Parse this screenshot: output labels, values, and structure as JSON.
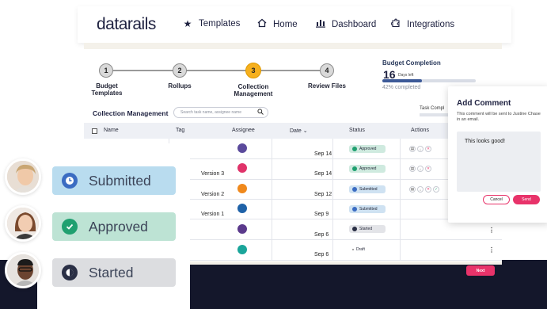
{
  "nav": {
    "logo": "datarails",
    "items": [
      {
        "label": "Templates",
        "icon": "star-icon"
      },
      {
        "label": "Home",
        "icon": "home-icon"
      },
      {
        "label": "Dashboard",
        "icon": "bar-chart-icon"
      },
      {
        "label": "Integrations",
        "icon": "puzzle-icon"
      }
    ]
  },
  "stepper": [
    {
      "num": "1",
      "label": "Budget\nTemplates"
    },
    {
      "num": "2",
      "label": "Rollups"
    },
    {
      "num": "3",
      "label": "Collection\nManagement"
    },
    {
      "num": "4",
      "label": "Review Files"
    }
  ],
  "budget": {
    "title": "Budget Completion",
    "days": "16",
    "days_label": "Days left",
    "completed": "42% completed",
    "progress": 0.42
  },
  "collection": {
    "title": "Collection Management",
    "search_placeholder": "Search task name, assignee name",
    "task_completion": "Task Compl"
  },
  "table": {
    "headers": {
      "name": "Name",
      "tag": "Tag",
      "assignee": "Assignee",
      "date": "Date",
      "status": "Status",
      "actions": "Actions"
    },
    "rows": [
      {
        "version": "",
        "date": "Sep 14",
        "assignee_color": "#5b4a9c",
        "status": "Approved"
      },
      {
        "version": "Version 3",
        "date": "Sep 14",
        "assignee_color": "#e0336a",
        "status": "Approved"
      },
      {
        "version": "Version 2",
        "date": "Sep 12",
        "assignee_color": "#f0891c",
        "status": "Submitted"
      },
      {
        "version": "Version 1",
        "date": "Sep 9",
        "assignee_color": "#1f62a8",
        "status": "Submitted"
      },
      {
        "version": "",
        "date": "Sep 6",
        "assignee_color": "#5b3a8c",
        "status": "Started"
      },
      {
        "version": "",
        "date": "Sep 6",
        "assignee_color": "#1aa59a",
        "status": "Draft"
      }
    ],
    "next_label": "Next"
  },
  "status_legend": [
    {
      "label": "Submitted",
      "bg": "#b9dcef",
      "icon": "clock-icon",
      "icon_color": "#3b6cc2"
    },
    {
      "label": "Approved",
      "bg": "#bde3d4",
      "icon": "check-circle-icon",
      "icon_color": "#20a070"
    },
    {
      "label": "Started",
      "bg": "#dcdde0",
      "icon": "half-circle-icon",
      "icon_color": "#2a2f45"
    }
  ],
  "comment": {
    "title": "Add Comment",
    "subtitle": "This comment will be sent to Justine Chase in an email.",
    "text": "This looks good!",
    "cancel": "Cancel",
    "send": "Send"
  }
}
